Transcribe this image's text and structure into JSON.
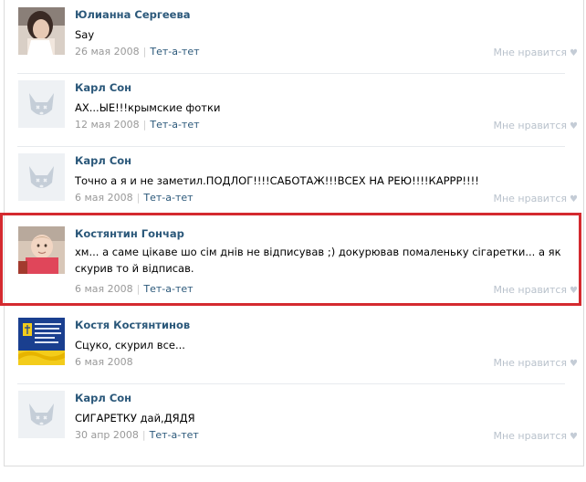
{
  "comments": [
    {
      "author": "Юлианна Сергеева",
      "text": "Say",
      "date": "26 мая 2008",
      "reply": "Тет-а-тет",
      "like": "Мне нравится",
      "avatar": "photo-woman-icon"
    },
    {
      "author": "Карл Сон",
      "text": "АХ...ЫЕ!!!крымские фотки",
      "date": "12 мая 2008",
      "reply": "Тет-а-тет",
      "like": "Мне нравится",
      "avatar": "default-dog-avatar-icon"
    },
    {
      "author": "Карл Сон",
      "text": "Точно а я и не заметил.ПОДЛОГ!!!!САБОТАЖ!!!ВСЕХ НА РЕЮ!!!!КАРРР!!!!",
      "date": "6 мая 2008",
      "reply": "Тет-а-тет",
      "like": "Мне нравится",
      "avatar": "default-dog-avatar-icon"
    },
    {
      "author": "Костянтин Гончар",
      "text": "хм... а саме цікаве шо сім днів не відписував ;) докурював помаленьку сігаретки... а як скурив то й відписав.",
      "date": "6 мая 2008",
      "reply": "Тет-а-тет",
      "like": "Мне нравится",
      "avatar": "photo-baby-icon"
    },
    {
      "author": "Костя Костянтинов",
      "text": "Сцуко, скурил все...",
      "date": "6 мая 2008",
      "reply": "",
      "like": "Мне нравится",
      "avatar": "emblem-icon"
    },
    {
      "author": "Карл Сон",
      "text": "СИГАРЕТКУ дай,ДЯДЯ",
      "date": "30 апр 2008",
      "reply": "Тет-а-тет",
      "like": "Мне нравится",
      "avatar": "default-dog-avatar-icon"
    }
  ],
  "colors": {
    "link": "#2b587a",
    "highlight": "#d42a2f",
    "meta": "#999999"
  }
}
